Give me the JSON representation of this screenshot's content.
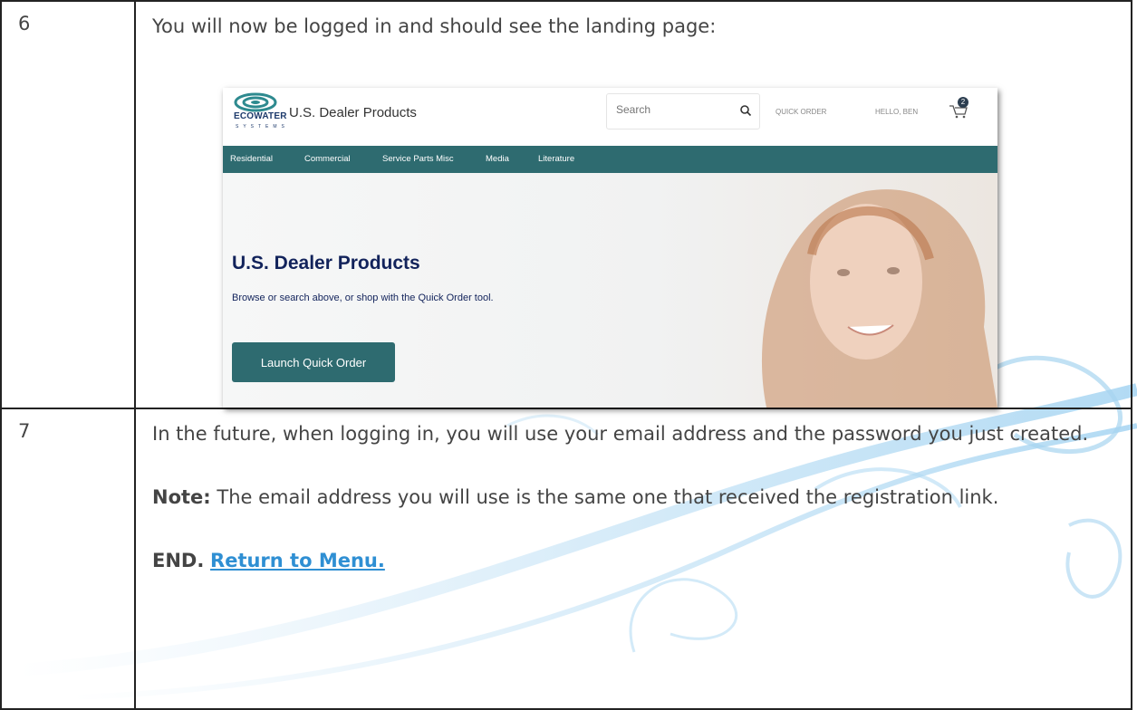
{
  "rows": [
    {
      "number": "6",
      "text": "You will now be logged in and should see the landing page:"
    },
    {
      "number": "7",
      "text": "In the future, when logging in, you will use your email address and the password you just created."
    }
  ],
  "note": {
    "label": "Note:",
    "text": " The email address you will use is the same one that received the registration link."
  },
  "end": {
    "label": "END.",
    "link": "Return to Menu."
  },
  "screenshot": {
    "logo_text": "ECOWATER",
    "logo_subtext": "SYSTEMS",
    "site_title": "U.S. Dealer Products",
    "search_placeholder": "Search",
    "quick_order_link": "QUICK ORDER",
    "greeting": "HELLO, BEN",
    "cart_count": "2",
    "nav": [
      "Residential",
      "Commercial",
      "Service Parts Misc",
      "Media",
      "Literature"
    ],
    "hero_title": "U.S. Dealer Products",
    "hero_subtitle": "Browse or search above, or shop with the Quick Order tool.",
    "hero_button": "Launch Quick Order",
    "icons": [
      "search-icon",
      "cart-icon",
      "ecowater-logo"
    ],
    "colors": {
      "nav_bg": "#2e6b70",
      "hero_title": "#12235b",
      "link": "#2f8fd3"
    }
  }
}
